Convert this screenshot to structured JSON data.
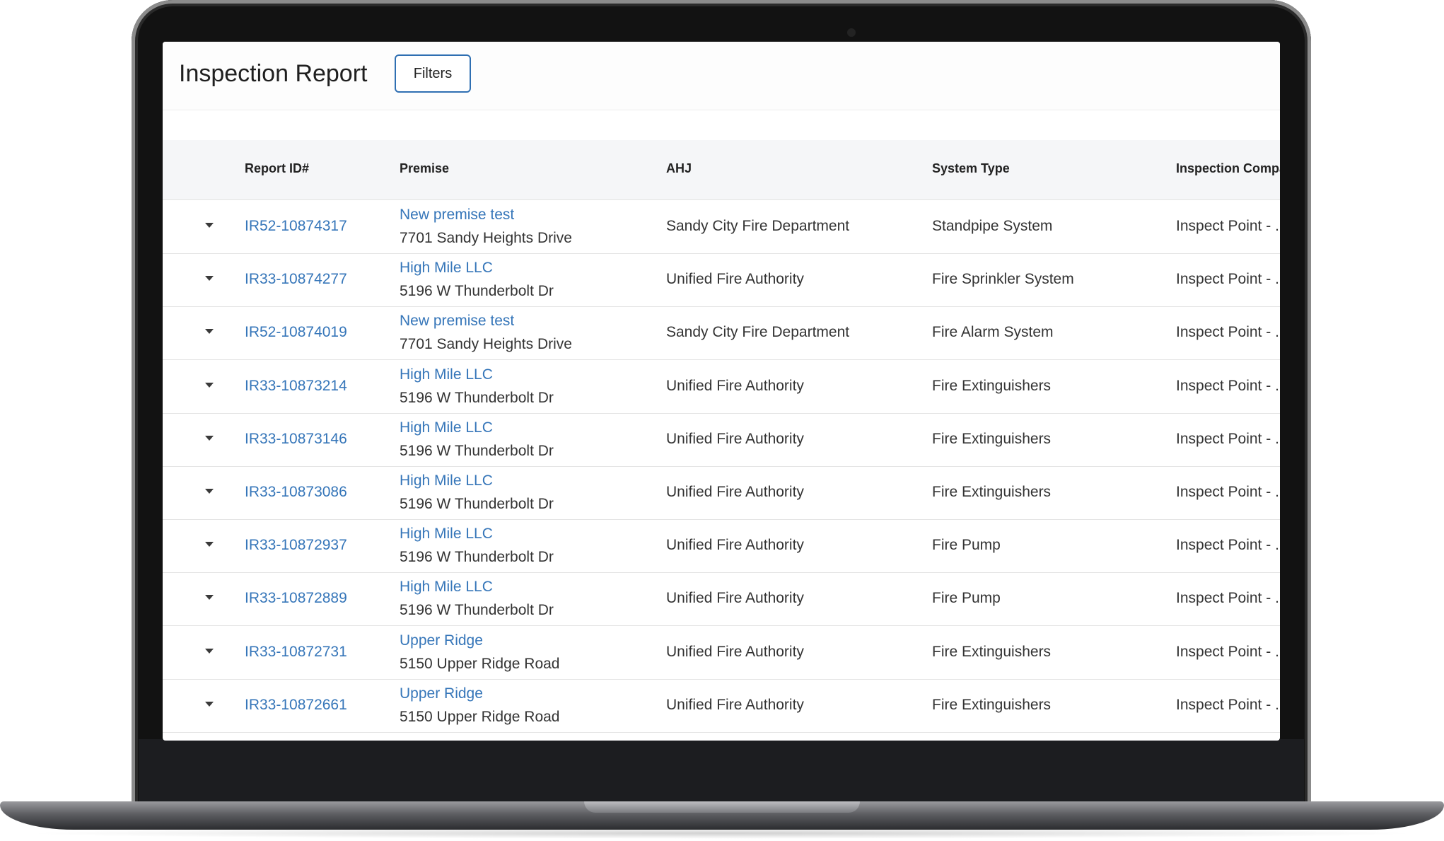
{
  "header": {
    "title": "Inspection Report",
    "filters_label": "Filters"
  },
  "table": {
    "columns": [
      "Report ID#",
      "Premise",
      "AHJ",
      "System Type",
      "Inspection Compa"
    ],
    "rows": [
      {
        "id": "IR52-10874317",
        "premise": "New premise test",
        "address": "7701 Sandy Heights Drive",
        "ahj": "Sandy City Fire Department",
        "system": "Standpipe System",
        "company": "Inspect Point - ."
      },
      {
        "id": "IR33-10874277",
        "premise": "High Mile LLC",
        "address": "5196 W Thunderbolt Dr",
        "ahj": "Unified Fire Authority",
        "system": "Fire Sprinkler System",
        "company": "Inspect Point - ."
      },
      {
        "id": "IR52-10874019",
        "premise": "New premise test",
        "address": "7701 Sandy Heights Drive",
        "ahj": "Sandy City Fire Department",
        "system": "Fire Alarm System",
        "company": "Inspect Point - ."
      },
      {
        "id": "IR33-10873214",
        "premise": "High Mile LLC",
        "address": "5196 W Thunderbolt Dr",
        "ahj": "Unified Fire Authority",
        "system": "Fire Extinguishers",
        "company": "Inspect Point - ."
      },
      {
        "id": "IR33-10873146",
        "premise": "High Mile LLC",
        "address": "5196 W Thunderbolt Dr",
        "ahj": "Unified Fire Authority",
        "system": "Fire Extinguishers",
        "company": "Inspect Point - ."
      },
      {
        "id": "IR33-10873086",
        "premise": "High Mile LLC",
        "address": "5196 W Thunderbolt Dr",
        "ahj": "Unified Fire Authority",
        "system": "Fire Extinguishers",
        "company": "Inspect Point - ."
      },
      {
        "id": "IR33-10872937",
        "premise": "High Mile LLC",
        "address": "5196 W Thunderbolt Dr",
        "ahj": "Unified Fire Authority",
        "system": "Fire Pump",
        "company": "Inspect Point - ."
      },
      {
        "id": "IR33-10872889",
        "premise": "High Mile LLC",
        "address": "5196 W Thunderbolt Dr",
        "ahj": "Unified Fire Authority",
        "system": "Fire Pump",
        "company": "Inspect Point - ."
      },
      {
        "id": "IR33-10872731",
        "premise": "Upper Ridge",
        "address": "5150 Upper Ridge Road",
        "ahj": "Unified Fire Authority",
        "system": "Fire Extinguishers",
        "company": "Inspect Point - ."
      },
      {
        "id": "IR33-10872661",
        "premise": "Upper Ridge",
        "address": "5150 Upper Ridge Road",
        "ahj": "Unified Fire Authority",
        "system": "Fire Extinguishers",
        "company": "Inspect Point - ."
      }
    ]
  },
  "icons": {
    "row_toggle": "caret-down-icon"
  },
  "colors": {
    "link": "#3676b9",
    "filters_border": "#2f6fb2",
    "header_bg": "#f5f6f8"
  }
}
